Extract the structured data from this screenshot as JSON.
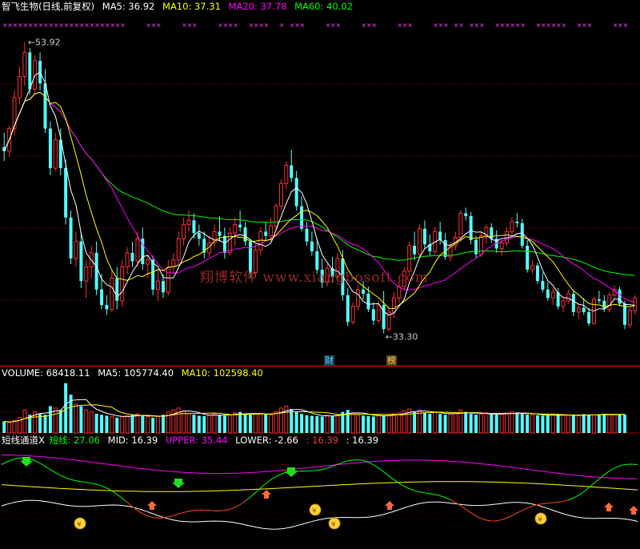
{
  "price_header": {
    "title": "智飞生物(日线,前复权)",
    "ma5": "MA5: 36.92",
    "ma10": "MA10: 37.31",
    "ma20": "MA20: 37.78",
    "ma60": "MA60: 40.02"
  },
  "volume_header": {
    "volume": "VOLUME: 68418.11",
    "ma5": "MA5: 105774.40",
    "ma10": "MA10: 102598.40"
  },
  "indicator_header": {
    "name": "短线通道X",
    "short": "短线: 27.06",
    "mid": "MID: 16.39",
    "upper": "UPPER: 35.44",
    "lower": "LOWER: -2.66",
    "extra1": ": 16.39",
    "extra2": ": 16.39"
  },
  "annotations": {
    "high_label": "53.92",
    "low_label": "33.30",
    "tag_fin": "财",
    "tag_bang": "榜",
    "watermark": "翔博软件  www.xiangbosoft.com"
  },
  "colors": {
    "up": "#ff3030",
    "down": "#54ffff",
    "ma5": "#ffffff",
    "ma10": "#ffff00",
    "ma20": "#ff00ff",
    "ma60": "#00ff00",
    "grid": "#7a0000",
    "short_line": "#00ff00",
    "mid_line": "#ffff00",
    "upper_line": "#ff00ff",
    "lower_line": "#ffffff"
  },
  "chart_data": [
    {
      "type": "candlestick",
      "title": "智飞生物(日线,前复权)",
      "ylim": [
        31,
        56
      ],
      "high_marker": 53.92,
      "low_marker": 33.3,
      "candles": [
        [
          46.5,
          47.5,
          45.5,
          46.2
        ],
        [
          46.2,
          48.0,
          45.8,
          47.8
        ],
        [
          47.8,
          50.5,
          47.3,
          50.0
        ],
        [
          50.0,
          52.2,
          49.5,
          51.5
        ],
        [
          51.5,
          53.92,
          50.8,
          53.2
        ],
        [
          53.2,
          53.5,
          50.2,
          50.6
        ],
        [
          50.6,
          53.0,
          50.2,
          52.6
        ],
        [
          52.6,
          53.2,
          50.5,
          51.0
        ],
        [
          51.0,
          52.0,
          47.5,
          47.8
        ],
        [
          47.8,
          48.3,
          44.5,
          45.0
        ],
        [
          45.0,
          47.5,
          44.8,
          47.0
        ],
        [
          47.0,
          47.8,
          44.5,
          45.0
        ],
        [
          45.0,
          45.6,
          41.0,
          41.5
        ],
        [
          41.5,
          42.0,
          38.2,
          38.6
        ],
        [
          38.6,
          40.5,
          38.0,
          39.8
        ],
        [
          39.8,
          40.5,
          36.5,
          37.0
        ],
        [
          37.0,
          38.5,
          35.8,
          38.0
        ],
        [
          38.0,
          39.5,
          37.2,
          39.0
        ],
        [
          39.0,
          39.8,
          36.0,
          36.4
        ],
        [
          36.4,
          37.5,
          35.0,
          35.3
        ],
        [
          35.3,
          36.0,
          34.6,
          35.0
        ],
        [
          35.0,
          37.8,
          34.8,
          37.2
        ],
        [
          37.2,
          38.0,
          35.0,
          35.6
        ],
        [
          35.6,
          38.5,
          35.2,
          38.0
        ],
        [
          38.0,
          39.4,
          37.5,
          39.0
        ],
        [
          39.0,
          39.8,
          38.0,
          38.4
        ],
        [
          38.4,
          40.5,
          38.0,
          40.0
        ],
        [
          40.0,
          40.8,
          37.8,
          38.2
        ],
        [
          38.2,
          38.9,
          37.2,
          38.5
        ],
        [
          38.5,
          38.8,
          36.0,
          36.4
        ],
        [
          36.4,
          37.8,
          35.6,
          37.0
        ],
        [
          37.0,
          37.5,
          35.8,
          36.2
        ],
        [
          36.2,
          38.5,
          36.0,
          38.0
        ],
        [
          38.0,
          39.0,
          37.5,
          38.5
        ],
        [
          38.5,
          40.5,
          38.2,
          40.0
        ],
        [
          40.0,
          41.5,
          39.5,
          41.0
        ],
        [
          41.0,
          42.0,
          40.5,
          41.3
        ],
        [
          41.3,
          41.8,
          40.0,
          40.4
        ],
        [
          40.4,
          41.0,
          39.5,
          40.0
        ],
        [
          40.0,
          40.5,
          38.6,
          39.0
        ],
        [
          39.0,
          40.2,
          38.7,
          39.7
        ],
        [
          39.7,
          41.0,
          39.3,
          40.5
        ],
        [
          40.5,
          41.6,
          39.8,
          40.2
        ],
        [
          40.2,
          40.8,
          38.6,
          39.0
        ],
        [
          39.0,
          40.8,
          38.8,
          40.4
        ],
        [
          40.4,
          41.5,
          39.5,
          41.0
        ],
        [
          41.0,
          42.0,
          40.5,
          40.8
        ],
        [
          40.8,
          41.2,
          39.5,
          39.8
        ],
        [
          39.8,
          40.0,
          37.2,
          37.6
        ],
        [
          37.6,
          39.6,
          37.3,
          39.2
        ],
        [
          39.2,
          40.8,
          38.8,
          40.5
        ],
        [
          40.5,
          41.2,
          39.8,
          40.2
        ],
        [
          40.2,
          41.5,
          39.8,
          40.9
        ],
        [
          40.9,
          42.5,
          40.5,
          42.3
        ],
        [
          42.3,
          44.2,
          42.0,
          43.9
        ],
        [
          43.9,
          45.5,
          43.5,
          45.2
        ],
        [
          45.2,
          46.3,
          44.0,
          44.3
        ],
        [
          44.3,
          44.8,
          42.0,
          42.3
        ],
        [
          42.3,
          43.0,
          40.5,
          40.7
        ],
        [
          40.7,
          41.2,
          39.5,
          39.8
        ],
        [
          39.8,
          40.5,
          38.8,
          39.1
        ],
        [
          39.1,
          40.0,
          37.5,
          37.8
        ],
        [
          37.8,
          38.6,
          36.5,
          36.9
        ],
        [
          36.9,
          38.2,
          36.6,
          37.9
        ],
        [
          37.9,
          38.7,
          36.9,
          37.3
        ],
        [
          37.3,
          39.0,
          37.0,
          38.6
        ],
        [
          38.6,
          39.2,
          35.6,
          36.0
        ],
        [
          36.0,
          36.5,
          33.8,
          34.1
        ],
        [
          34.1,
          35.5,
          33.9,
          35.2
        ],
        [
          35.2,
          36.7,
          34.9,
          36.4
        ],
        [
          36.4,
          37.0,
          35.7,
          36.1
        ],
        [
          36.1,
          36.6,
          34.8,
          35.0
        ],
        [
          35.0,
          35.5,
          33.9,
          34.2
        ],
        [
          34.2,
          35.6,
          34.0,
          35.3
        ],
        [
          35.3,
          36.3,
          33.3,
          33.6
        ],
        [
          33.6,
          35.2,
          33.4,
          34.8
        ],
        [
          34.8,
          36.2,
          34.4,
          35.8
        ],
        [
          35.8,
          37.0,
          35.4,
          36.6
        ],
        [
          36.6,
          38.0,
          36.3,
          37.7
        ],
        [
          37.7,
          39.8,
          37.5,
          39.5
        ],
        [
          39.5,
          40.5,
          38.5,
          38.9
        ],
        [
          38.9,
          41.0,
          38.7,
          40.7
        ],
        [
          40.7,
          41.3,
          39.3,
          39.6
        ],
        [
          39.6,
          40.3,
          38.8,
          39.1
        ],
        [
          39.1,
          40.8,
          38.9,
          40.5
        ],
        [
          40.5,
          41.2,
          39.6,
          39.9
        ],
        [
          39.9,
          40.4,
          38.5,
          38.7
        ],
        [
          38.7,
          39.8,
          38.4,
          39.5
        ],
        [
          39.5,
          40.5,
          39.2,
          40.1
        ],
        [
          40.1,
          42.0,
          39.9,
          41.8
        ],
        [
          41.8,
          42.2,
          41.3,
          41.6
        ],
        [
          41.6,
          41.9,
          39.6,
          39.9
        ],
        [
          39.9,
          40.2,
          38.6,
          38.9
        ],
        [
          38.9,
          40.5,
          38.7,
          40.2
        ],
        [
          40.2,
          41.0,
          39.6,
          40.8
        ],
        [
          40.8,
          41.1,
          39.7,
          40.0
        ],
        [
          40.0,
          40.6,
          39.0,
          39.3
        ],
        [
          39.3,
          39.9,
          38.8,
          39.7
        ],
        [
          39.7,
          40.8,
          39.5,
          40.5
        ],
        [
          40.5,
          41.5,
          40.3,
          41.2
        ],
        [
          41.2,
          41.8,
          40.8,
          41.1
        ],
        [
          41.1,
          41.4,
          39.3,
          39.5
        ],
        [
          39.5,
          39.9,
          37.6,
          37.8
        ],
        [
          37.8,
          38.5,
          37.5,
          38.1
        ],
        [
          38.1,
          38.3,
          36.8,
          37.0
        ],
        [
          37.0,
          37.6,
          36.2,
          36.4
        ],
        [
          36.4,
          36.9,
          35.6,
          35.8
        ],
        [
          35.8,
          36.5,
          35.3,
          36.2
        ],
        [
          36.2,
          36.5,
          35.0,
          35.2
        ],
        [
          35.2,
          35.9,
          34.8,
          35.6
        ],
        [
          35.6,
          36.4,
          35.4,
          36.1
        ],
        [
          36.1,
          36.4,
          34.5,
          34.8
        ],
        [
          34.8,
          35.3,
          34.3,
          35.1
        ],
        [
          35.1,
          35.8,
          34.6,
          34.8
        ],
        [
          34.8,
          35.1,
          33.8,
          34.0
        ],
        [
          34.0,
          35.9,
          33.9,
          35.7
        ],
        [
          35.7,
          36.3,
          35.4,
          35.6
        ],
        [
          35.6,
          36.0,
          34.8,
          35.0
        ],
        [
          35.0,
          36.2,
          34.8,
          36.0
        ],
        [
          36.0,
          36.7,
          35.8,
          36.4
        ],
        [
          36.4,
          36.6,
          35.2,
          35.4
        ],
        [
          35.4,
          35.6,
          33.6,
          33.9
        ],
        [
          33.9,
          35.1,
          33.7,
          34.9
        ],
        [
          34.9,
          36.0,
          34.6,
          35.8
        ]
      ],
      "ma5_labels": [
        "MA5",
        "MA10",
        "MA20",
        "MA60"
      ]
    },
    {
      "type": "bar",
      "title": "VOLUME",
      "volume": [
        60,
        55,
        65,
        80,
        120,
        95,
        110,
        100,
        95,
        140,
        130,
        120,
        260,
        200,
        150,
        140,
        120,
        110,
        100,
        95,
        90,
        85,
        80,
        85,
        90,
        95,
        100,
        90,
        85,
        80,
        85,
        95,
        110,
        120,
        130,
        115,
        100,
        95,
        90,
        88,
        92,
        100,
        95,
        90,
        95,
        105,
        110,
        100,
        95,
        98,
        102,
        100,
        96,
        110,
        130,
        140,
        125,
        110,
        100,
        92,
        90,
        88,
        86,
        92,
        90,
        95,
        110,
        120,
        105,
        95,
        90,
        88,
        86,
        95,
        90,
        92,
        100,
        105,
        115,
        125,
        110,
        118,
        105,
        100,
        110,
        100,
        95,
        98,
        102,
        120,
        110,
        100,
        95,
        98,
        105,
        100,
        96,
        98,
        104,
        110,
        108,
        100,
        96,
        94,
        92,
        90,
        94,
        92,
        96,
        95,
        92,
        94,
        90,
        98,
        96,
        94,
        98,
        100,
        96,
        95,
        98,
        96
      ]
    },
    {
      "type": "line",
      "title": "短线通道X",
      "series": [
        {
          "name": "短线",
          "color": "#00ff00"
        },
        {
          "name": "MID",
          "color": "#ffff00"
        },
        {
          "name": "UPPER",
          "color": "#ff00ff"
        },
        {
          "name": "LOWER",
          "color": "#ffffff"
        }
      ]
    }
  ]
}
